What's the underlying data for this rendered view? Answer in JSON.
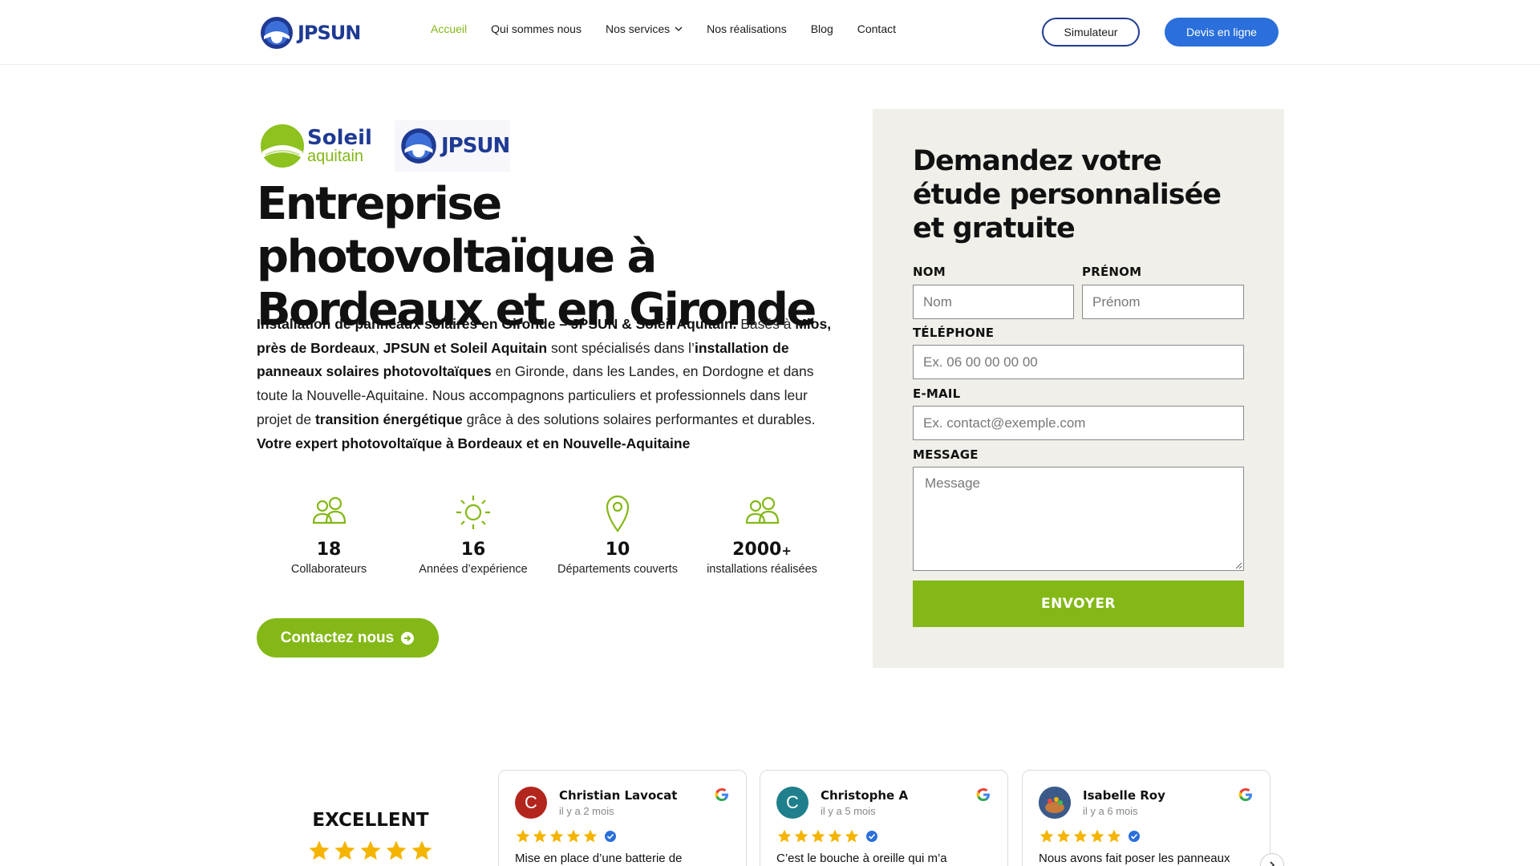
{
  "header": {
    "logo_text": "JPSUN",
    "nav": [
      {
        "label": "Accueil",
        "active": true
      },
      {
        "label": "Qui sommes nous",
        "active": false
      },
      {
        "label": "Nos services",
        "active": false,
        "dropdown": true
      },
      {
        "label": "Nos réalisations",
        "active": false
      },
      {
        "label": "Blog",
        "active": false
      },
      {
        "label": "Contact",
        "active": false
      }
    ],
    "simulator_label": "Simulateur",
    "quote_label": "Devis en ligne"
  },
  "brands": {
    "soleil_top": "Soleil",
    "soleil_bottom": "aquitain",
    "jpsun": "JPSUN"
  },
  "hero": {
    "title": "Entreprise photovoltaïque à Bordeaux et en Gironde",
    "paragraph": [
      {
        "text": "Installation de panneaux solaires en Gironde – JPSUN & Soleil Aquitain.",
        "bold": true
      },
      {
        "text": " Basés à ",
        "bold": false
      },
      {
        "text": "Mios, près de Bordeaux",
        "bold": true
      },
      {
        "text": ", ",
        "bold": false
      },
      {
        "text": "JPSUN et Soleil Aquitain",
        "bold": true
      },
      {
        "text": " sont spécialisés dans l’",
        "bold": false
      },
      {
        "text": "installation de panneaux solaires photovoltaïques",
        "bold": true
      },
      {
        "text": " en Gironde, dans les Landes, en Dordogne et dans toute la Nouvelle-Aquitaine. Nous accompagnons particuliers et professionnels dans leur projet de ",
        "bold": false
      },
      {
        "text": "transition énergétique",
        "bold": true
      },
      {
        "text": " grâce à des solutions solaires performantes et durables. ",
        "bold": false
      },
      {
        "text": "Votre expert photovoltaïque à Bordeaux et en Nouvelle-Aquitaine",
        "bold": true
      }
    ],
    "stats": [
      {
        "icon": "people-icon",
        "number": "18",
        "plus": "",
        "label": "Collaborateurs"
      },
      {
        "icon": "sun-icon",
        "number": "16",
        "plus": "",
        "label": "Années d’expérience"
      },
      {
        "icon": "map-pin-icon",
        "number": "10",
        "plus": "",
        "label": "Départements couverts"
      },
      {
        "icon": "people-icon",
        "number": "2000",
        "plus": "+",
        "label": "installations réalisées"
      }
    ],
    "contact_label": "Contactez nous"
  },
  "form": {
    "title": "Demandez votre étude personnalisée et gratuite",
    "nom_label": "NOM",
    "nom_placeholder": "Nom",
    "prenom_label": "PRÉNOM",
    "prenom_placeholder": "Prénom",
    "tel_label": "TÉLÉPHONE",
    "tel_placeholder": "Ex. 06 00 00 00 00",
    "email_label": "E-MAIL",
    "email_placeholder": "Ex. contact@exemple.com",
    "message_label": "MESSAGE",
    "message_placeholder": "Message",
    "submit_label": "ENVOYER"
  },
  "reviews": {
    "summary_label": "EXCELLENT",
    "summary_stars": 5,
    "items": [
      {
        "initial": "C",
        "avatar_color": "#b3261e",
        "name": "Christian Lavocat",
        "time": "il y a 2 mois",
        "stars": 5,
        "text": "Mise en place d’une batterie de"
      },
      {
        "initial": "C",
        "avatar_color": "#1f7f8c",
        "name": "Christophe A",
        "time": "il y a 5 mois",
        "stars": 5,
        "text": "C’est le bouche à oreille qui m’a"
      },
      {
        "initial": "",
        "avatar_color": "#3b5a8a",
        "name": "Isabelle Roy",
        "time": "il y a 6 mois",
        "stars": 5,
        "text": "Nous avons fait poser les panneaux"
      }
    ]
  },
  "colors": {
    "accent_green": "#84b817",
    "brand_blue": "#1f3a93",
    "button_blue": "#2a6fdb",
    "form_bg": "#f0efe9",
    "star_gold": "#f4b400"
  }
}
